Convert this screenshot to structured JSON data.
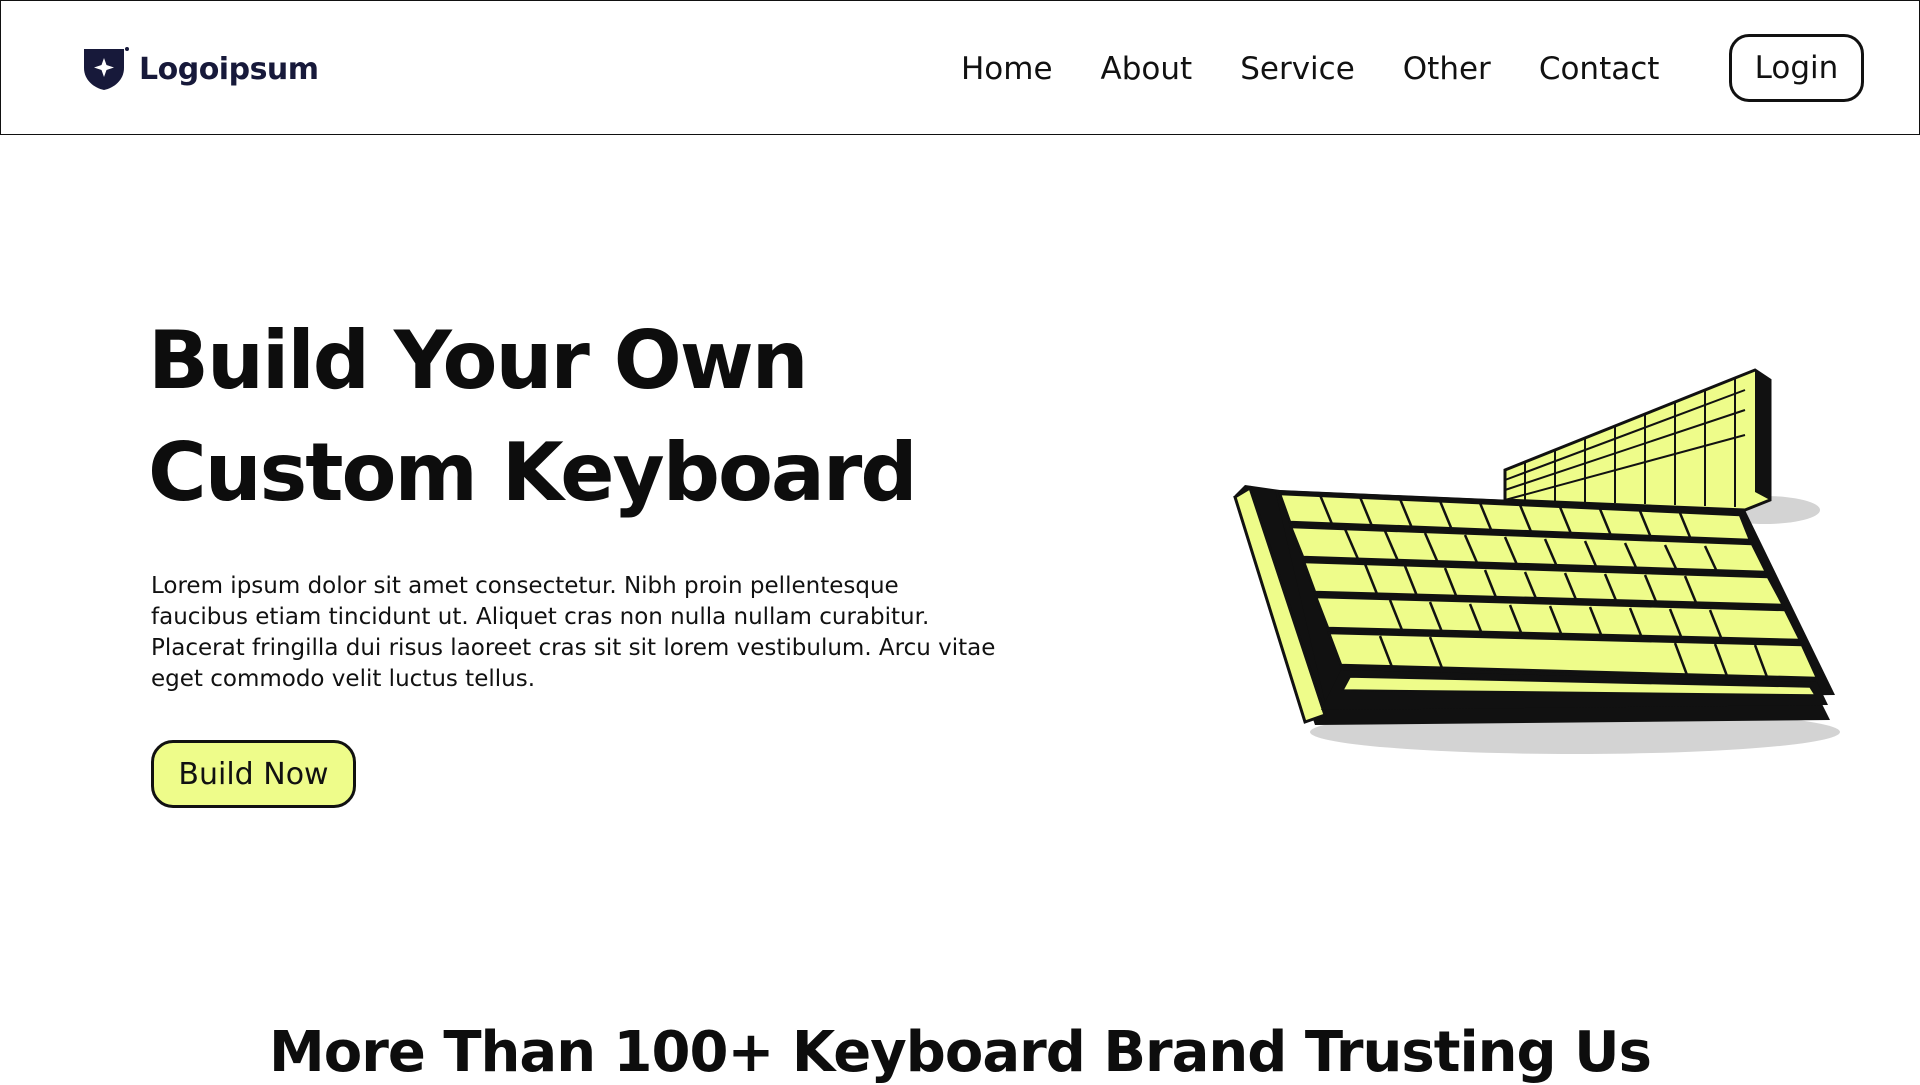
{
  "brand": {
    "name": "Logoipsum",
    "logo_icon": "shield-sparkle-icon",
    "color": "#17193a"
  },
  "nav": {
    "links": [
      "Home",
      "About",
      "Service",
      "Other",
      "Contact"
    ],
    "login_label": "Login"
  },
  "hero": {
    "title": "Build Your Own Custom Keyboard",
    "description": "Lorem ipsum dolor sit amet consectetur. Nibh proin pellentesque faucibus etiam tincidunt ut. Aliquet cras non nulla nullam curabitur. Placerat fringilla dui risus laoreet cras sit sit lorem vestibulum. Arcu vitae eget commodo velit luctus tellus.",
    "cta_label": "Build Now",
    "illustration": "keyboard-illustration"
  },
  "section": {
    "title": "More Than 100+ Keyboard Brand Trusting Us"
  },
  "colors": {
    "accent": "#eefc8a",
    "text": "#0d0d0d",
    "border": "#111111",
    "shadow": "#d3d3d3"
  }
}
